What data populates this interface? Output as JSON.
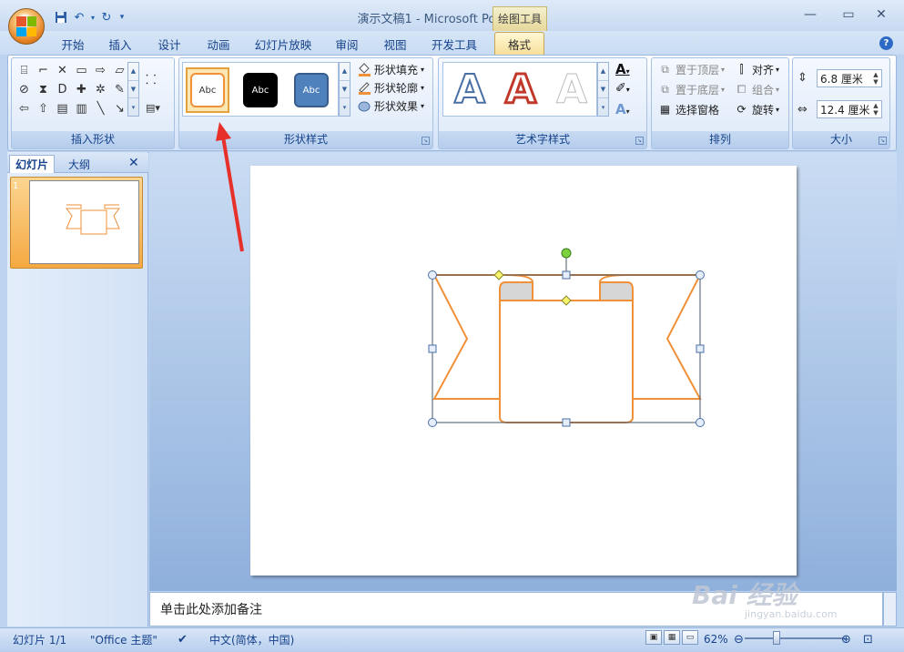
{
  "titlebar": {
    "doc_title": "演示文稿1 - Microsoft PowerPoint",
    "context_tab_title": "绘图工具"
  },
  "tabs": [
    "开始",
    "插入",
    "设计",
    "动画",
    "幻灯片放映",
    "审阅",
    "视图",
    "开发工具",
    "格式"
  ],
  "ribbon": {
    "insert_shapes": {
      "label": "插入形状"
    },
    "shape_styles": {
      "label": "形状样式",
      "swatch_text": "Abc",
      "fill": "形状填充",
      "outline": "形状轮廓",
      "effects": "形状效果"
    },
    "wordart": {
      "label": "艺术字样式",
      "glyph": "A"
    },
    "arrange": {
      "label": "排列",
      "bring_front": "置于顶层",
      "send_back": "置于底层",
      "selection_pane": "选择窗格",
      "align": "对齐",
      "group": "组合",
      "rotate": "旋转"
    },
    "size": {
      "label": "大小",
      "height": "6.8 厘米",
      "width": "12.4 厘米"
    }
  },
  "left_panel": {
    "tab_slides": "幻灯片",
    "tab_outline": "大纲",
    "slide_number": "1"
  },
  "notes": {
    "placeholder": "单击此处添加备注"
  },
  "status": {
    "slide": "幻灯片 1/1",
    "theme": "\"Office 主题\"",
    "language": "中文(简体，中国)",
    "zoom": "62%"
  },
  "watermark": {
    "text": "Bai 经验",
    "sub": "jingyan.baidu.com"
  },
  "colors": {
    "accent_orange": "#f0913a",
    "ribbon_blue": "#15428b",
    "highlight": "#f6df98"
  }
}
